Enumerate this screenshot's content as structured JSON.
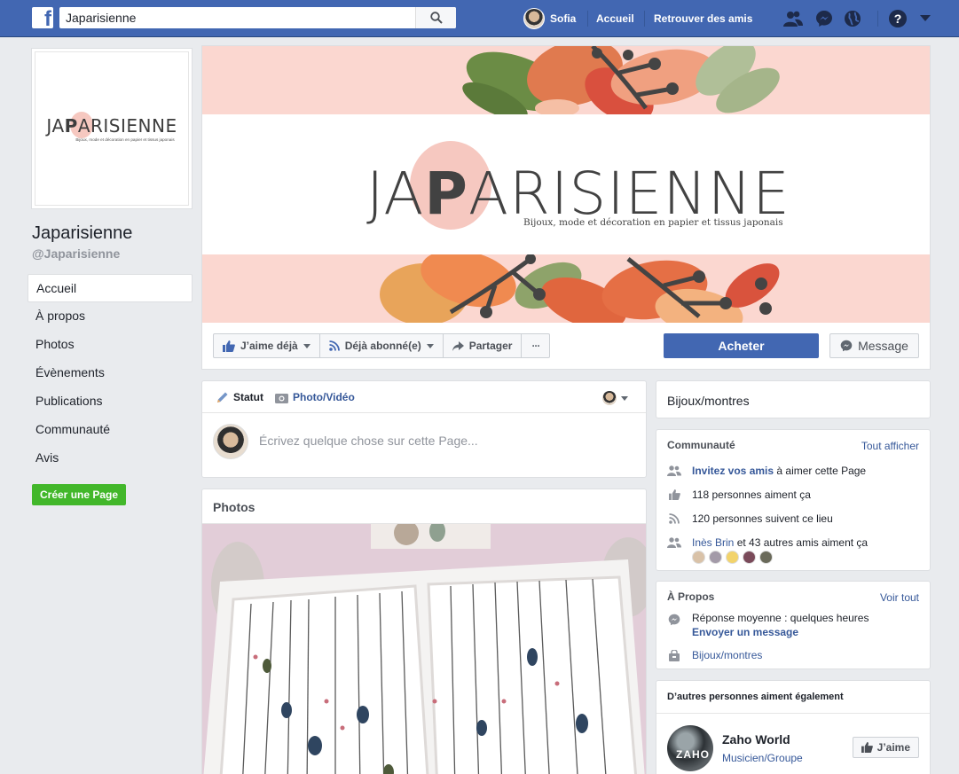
{
  "topbar": {
    "logo_letter": "f",
    "search_value": "Japarisienne",
    "user_name": "Sofia",
    "home": "Accueil",
    "find_friends": "Retrouver des amis",
    "icons": [
      "friends-icon",
      "messenger-icon",
      "globe-icon",
      "help-icon",
      "caret-down-icon"
    ]
  },
  "profile": {
    "logo_text_left": "JA",
    "logo_text_right": "ARISIENNE",
    "logo_tagline": "Bijoux, mode et décoration en papier et tissus japonais",
    "name": "Japarisienne",
    "handle": "@Japarisienne"
  },
  "left_nav": {
    "items": [
      {
        "label": "Accueil"
      },
      {
        "label": "À propos"
      },
      {
        "label": "Photos"
      },
      {
        "label": "Évènements"
      },
      {
        "label": "Publications"
      },
      {
        "label": "Communauté"
      },
      {
        "label": "Avis"
      }
    ],
    "create_page": "Créer une Page"
  },
  "cover": {
    "logo_left": "JA",
    "logo_right": "ARISIENNE",
    "tagline": "Bijoux, mode et décoration en papier et tissus japonais"
  },
  "actions": {
    "liked": "J’aime déjà",
    "following": "Déjà abonné(e)",
    "share": "Partager",
    "more": "···",
    "buy": "Acheter",
    "message": "Message"
  },
  "composer": {
    "status": "Statut",
    "photo_video": "Photo/Vidéo",
    "placeholder": "Écrivez quelque chose sur cette Page..."
  },
  "photos": {
    "title": "Photos"
  },
  "right": {
    "category": "Bijoux/montres",
    "community": {
      "title": "Communauté",
      "see_all": "Tout afficher",
      "invite_link": "Invitez vos amis",
      "invite_rest": " à aimer cette Page",
      "likes": "118 personnes aiment ça",
      "follows": "120 personnes suivent ce lieu",
      "friend_link": "Inès Brin",
      "friend_rest": " et 43 autres amis aiment ça"
    },
    "about": {
      "title": "À Propos",
      "see_all": "Voir tout",
      "response": "Réponse moyenne : quelques heures",
      "send_message": "Envoyer un message",
      "category": "Bijoux/montres"
    },
    "also_like": {
      "title": "D’autres personnes aiment également",
      "page_name": "Zaho World",
      "page_type": "Musicien/Groupe",
      "thumb_text": "ZAHO",
      "like_btn": "J’aime"
    }
  },
  "colors": {
    "fb_blue": "#4267b2",
    "link": "#365899",
    "green": "#42b72a",
    "cover_pink": "#fbd7d0"
  }
}
